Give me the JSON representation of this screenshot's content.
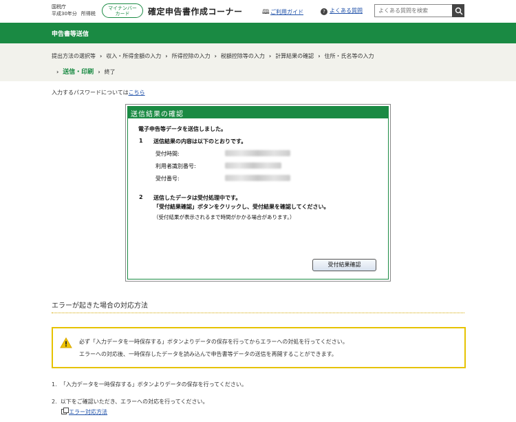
{
  "header": {
    "agency": "国税庁",
    "year": "平成30年分",
    "tax_type": "所得税",
    "mynumber_badge_line1": "マイナンバー",
    "mynumber_badge_line2": "カード",
    "app_title": "確定申告書作成コーナー",
    "guide_link": "ご利用ガイド",
    "guide_icon": "book-icon",
    "faq_link": "よくある質問",
    "faq_icon": "question-icon",
    "search_placeholder": "よくある質問を検索",
    "search_icon": "search-icon"
  },
  "section_bar": {
    "title": "申告書等送信"
  },
  "steps": {
    "row1": [
      "提出方法の選択等",
      "収入・所得金額の入力",
      "所得控除の入力",
      "税額控除等の入力",
      "計算結果の確認",
      "住所・氏名等の入力"
    ],
    "current": "送信・印刷",
    "last": "終了"
  },
  "password_note": {
    "text": "入力するパスワードについては",
    "link": "こちら"
  },
  "result_panel": {
    "title": "送信結果の確認",
    "sent_message": "電子申告等データを送信しました。",
    "item1_num": "1",
    "item1_text": "送信結果の内容は以下のとおりです。",
    "fields": [
      {
        "label": "受付時間:"
      },
      {
        "label": "利用者識別番号:"
      },
      {
        "label": "受付番号:"
      }
    ],
    "item2_num": "2",
    "item2_line1": "送信したデータは受付処理中です。",
    "item2_line2": "「受付結果確認」ボタンをクリックし、受付結果を確認してください。",
    "item2_note": "（受付結果が表示されるまで時間がかかる場合があります。）",
    "confirm_button": "受付結果確認"
  },
  "error_section": {
    "heading": "エラーが起きた場合の対応方法",
    "warning_icon": "warning-icon",
    "warning_line1": "必ず「入力データを一時保存する」ボタンよりデータの保存を行ってからエラーへの対処を行ってください。",
    "warning_line2": "エラーへの対応後、一時保存したデータを読み込んで申告書等データの送信を再開することができます。",
    "list": [
      {
        "num": "1.",
        "text": "「入力データを一時保存する」ボタンよりデータの保存を行ってください。"
      },
      {
        "num": "2.",
        "text": "以下をご確認いただき、エラーへの対応を行ってください。"
      }
    ],
    "sub_link": "エラー対応方法",
    "sub_link_icon": "external-window-icon"
  },
  "colors": {
    "brand_green": "#1a8a43",
    "link_blue": "#1d4fa8",
    "warning_border": "#e6c200",
    "steps_bg": "#f2f2ec"
  }
}
